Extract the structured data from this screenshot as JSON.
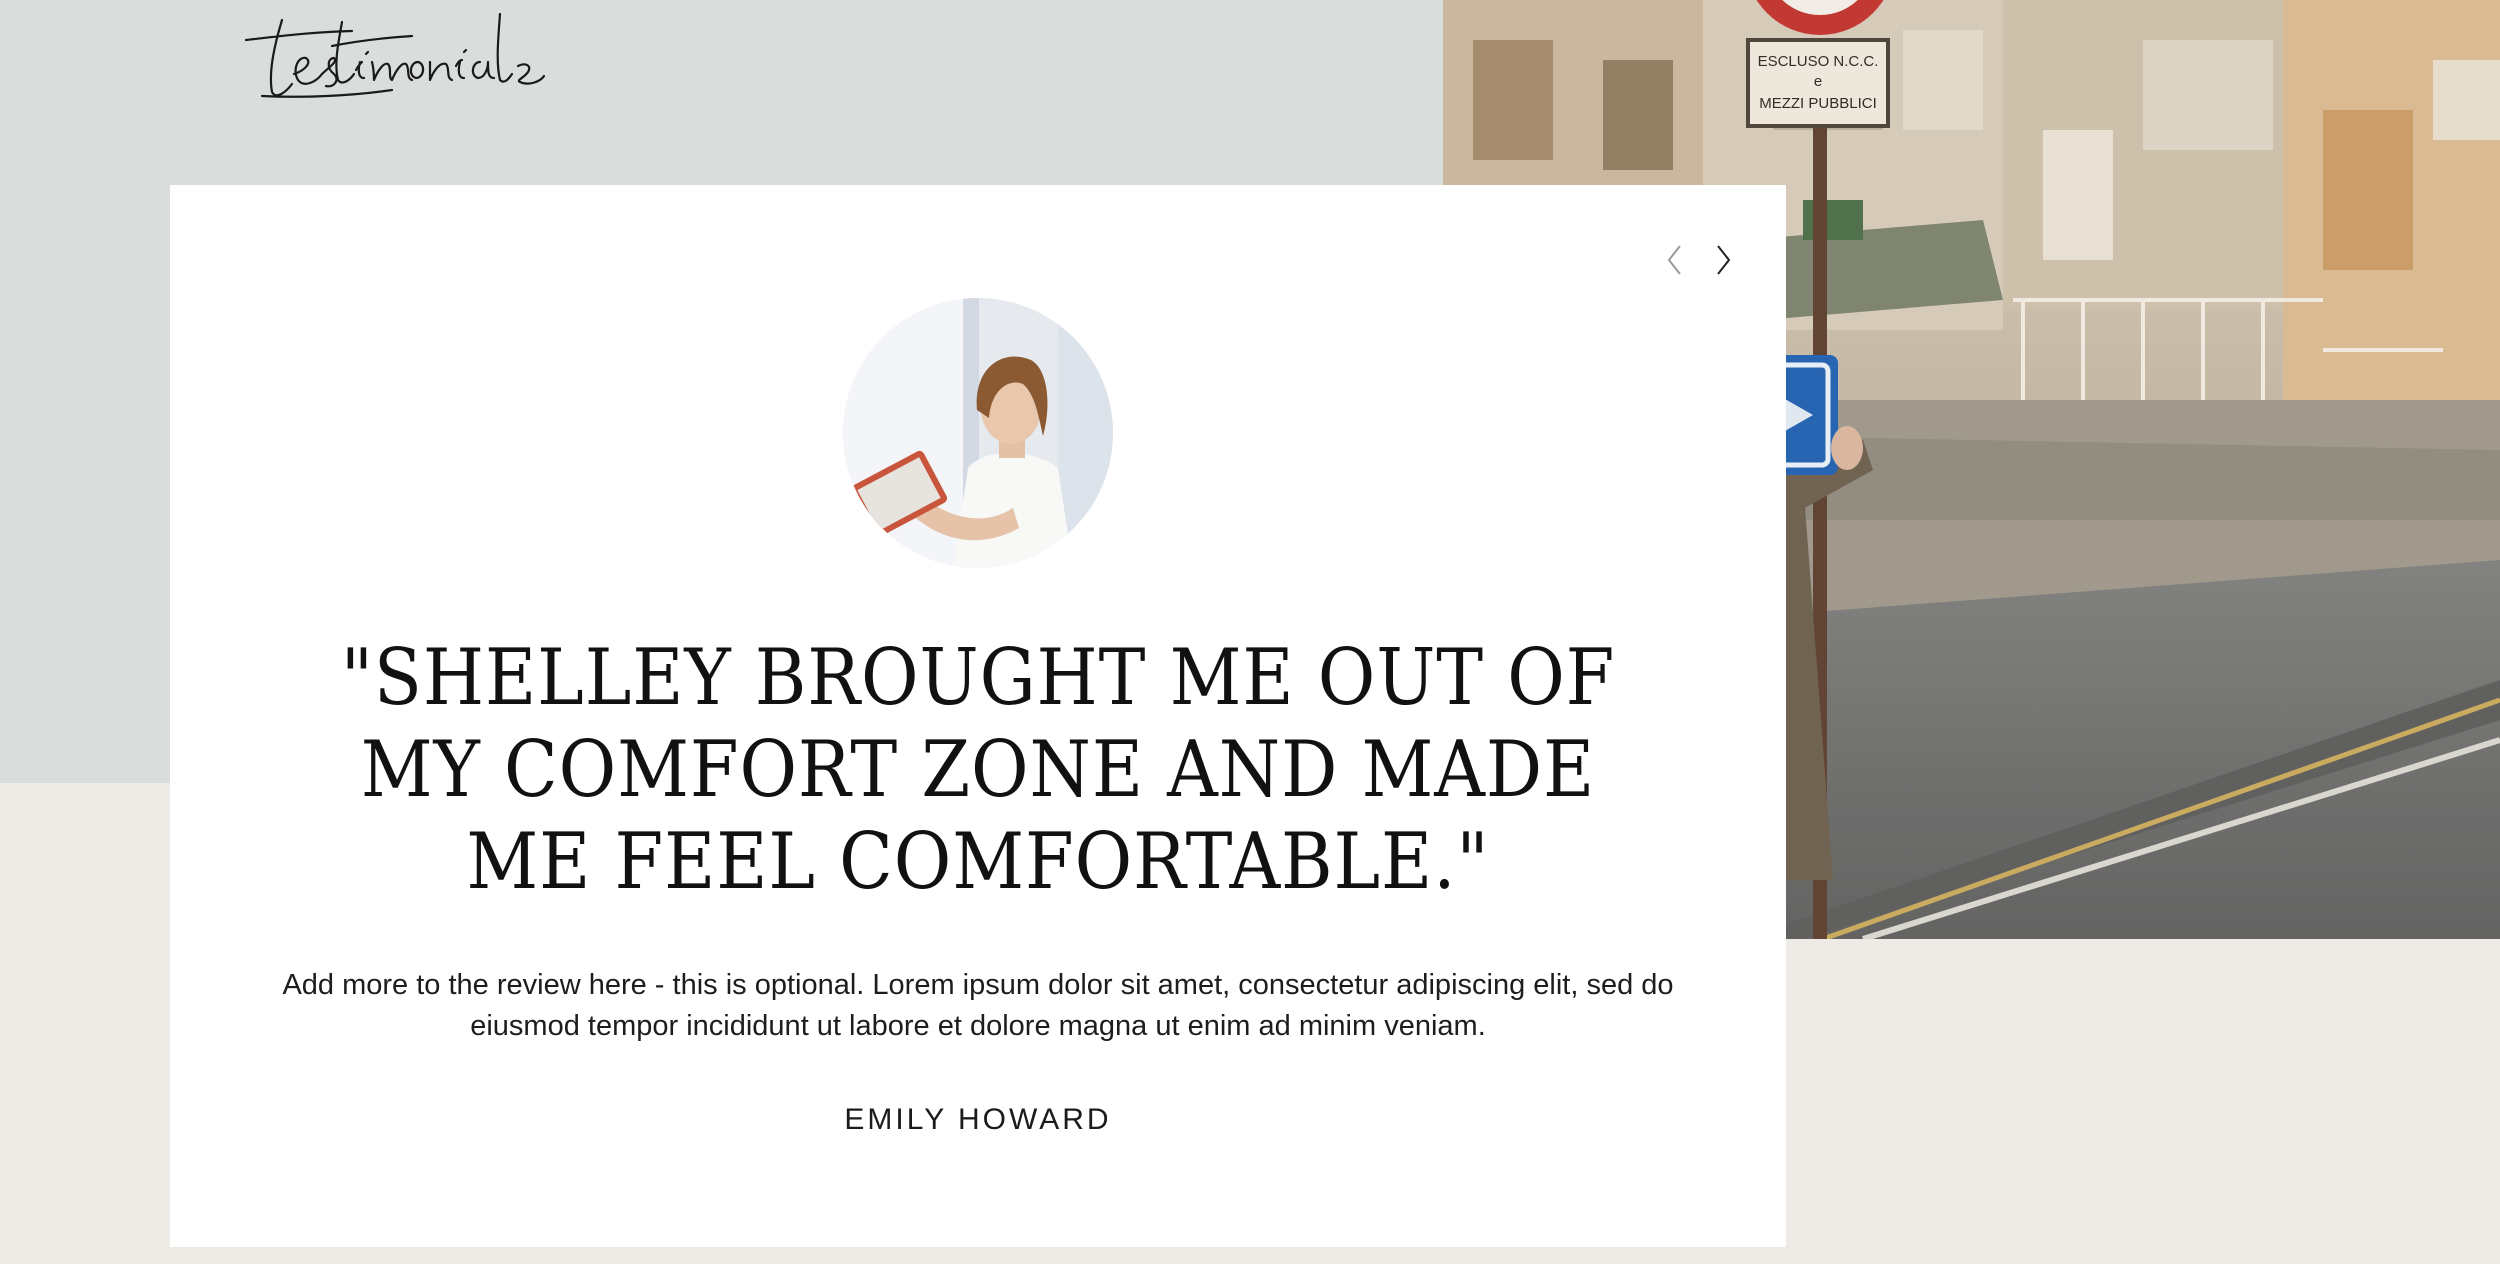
{
  "section": {
    "heading": "testimonials"
  },
  "navigation": {
    "prev_icon": "chevron-left-icon",
    "next_icon": "chevron-right-icon"
  },
  "testimonial": {
    "quote": "\"SHELLEY BROUGHT ME OUT OF MY COMFORT ZONE AND MADE ME FEEL COMFORTABLE.\"",
    "body": "Add more to the review here - this is optional. Lorem ipsum dolor sit amet, consectetur adipiscing elit, sed do eiusmod tempor incididunt ut labore et dolore magna ut enim ad minim veniam.",
    "reviewer_name": "EMILY HOWARD"
  },
  "photo": {
    "sign_text": [
      "ESCLUSO N.C.C.",
      "e",
      "MEZZI PUBBLICI"
    ]
  },
  "colors": {
    "top_band": "#d9dedc",
    "page_background": "#eeebe6",
    "card_background": "#ffffff",
    "text": "#111111",
    "sign_blue": "#1f5fb0"
  }
}
